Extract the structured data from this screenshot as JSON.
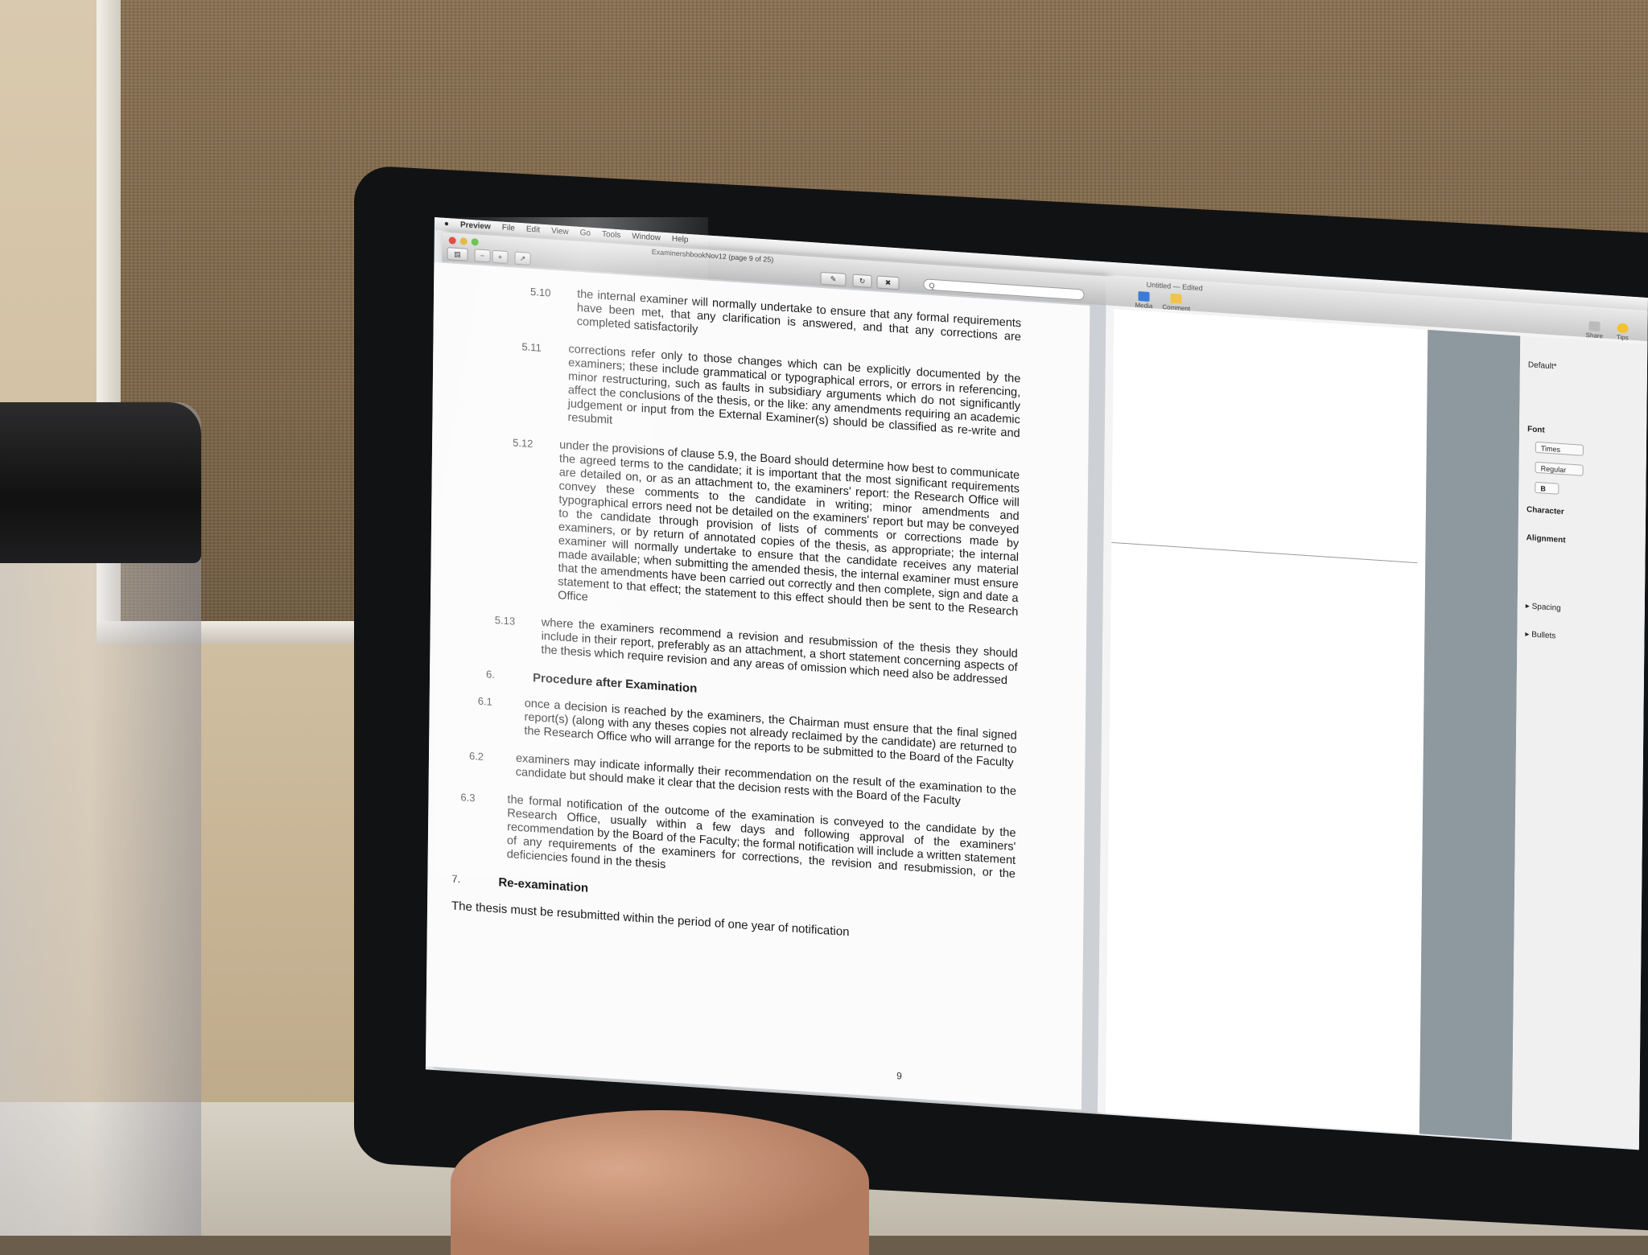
{
  "menubar": {
    "app": "Preview",
    "items": [
      "File",
      "Edit",
      "View",
      "Go",
      "Tools",
      "Window",
      "Help"
    ]
  },
  "preview": {
    "title": "ExaminershbookNov12 (page 9 of 25)",
    "search_placeholder": "Q"
  },
  "document": {
    "paragraphs": [
      {
        "num": "5.10",
        "text": "the internal examiner will normally undertake to ensure that any formal requirements have been met, that any clarification is answered, and that any corrections are completed satisfactorily"
      },
      {
        "num": "5.11",
        "text": "corrections refer only to those changes which can be explicitly documented by the examiners; these include grammatical or typographical errors, or errors in referencing, minor restructuring, such as faults in subsidiary arguments which do not significantly affect the conclusions of the thesis, or the like: any amendments requiring an academic judgement or input from the External Examiner(s) should be classified as re-write and resubmit"
      },
      {
        "num": "5.12",
        "text": "under the provisions of clause 5.9, the Board should determine how best to communicate the agreed terms to the candidate; it is important that the most significant requirements are detailed on, or as an attachment to, the examiners' report: the Research Office will convey these comments to the candidate in writing; minor amendments and typographical errors need not be detailed on the examiners' report but may be conveyed to the candidate through provision of lists of comments or corrections made by examiners, or by return of annotated copies of the thesis, as appropriate; the internal examiner will normally undertake to ensure that the candidate receives any material made available; when submitting the amended thesis, the internal examiner must ensure that the amendments have been carried out correctly and then complete, sign and date a statement to that effect; the statement to this effect should then be sent to the Research Office"
      },
      {
        "num": "5.13",
        "text": "where the examiners recommend a revision and resubmission of the thesis they should include in their report, preferably as an attachment, a short statement concerning aspects of the thesis which require revision and any areas of omission which need also be addressed"
      }
    ],
    "heading6": {
      "num": "6.",
      "text": "Procedure after Examination"
    },
    "paragraphs6": [
      {
        "num": "6.1",
        "text": "once a decision is reached by the examiners, the Chairman must ensure that the final signed report(s) (along with any theses copies not already reclaimed by the candidate) are returned to the Research Office who will arrange for the reports to be submitted to the Board of the Faculty"
      },
      {
        "num": "6.2",
        "text": "examiners may indicate informally their recommendation on the result of the examination to the candidate but should make it clear that the decision rests with the Board of the Faculty"
      },
      {
        "num": "6.3",
        "text": "the formal notification of the outcome of the examination is conveyed to the candidate by the Research Office, usually within a few days and following approval of the examiners' recommendation by the Board of the Faculty; the formal notification will include a written statement of any requirements of the examiners for corrections, the revision and resubmission, or the deficiencies found in the thesis"
      }
    ],
    "heading7": {
      "num": "7.",
      "text": "Re-examination"
    },
    "closing": "The thesis must be resubmitted within the period of one year of notification",
    "page_number": "9"
  },
  "editor": {
    "title": "Untitled — Edited",
    "tools": [
      "Media",
      "Comment",
      "Share",
      "Tips"
    ],
    "inspector": {
      "style": "Default*",
      "font_label": "Font",
      "font_name": "Times",
      "font_style": "Regular",
      "bold": "B",
      "character_label": "Character",
      "alignment_label": "Alignment",
      "spacing_label": "Spacing",
      "bullets_label": "Bullets"
    }
  },
  "colors": {
    "close": "#e0453c",
    "minimize": "#e3b534",
    "zoom": "#5fbc3f"
  }
}
